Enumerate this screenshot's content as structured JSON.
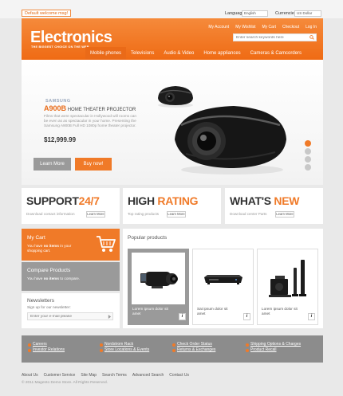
{
  "topbar": {
    "welcome": "Default welcome msg!",
    "language_label": "Language:",
    "language_value": "English",
    "currency_label": "Currencies:",
    "currency_value": "US Dollar"
  },
  "header": {
    "logo": "Electronics",
    "tagline": "THE BIGGEST CHOICE ON THE WEB",
    "links": [
      "My Account",
      "My Wishlist",
      "My Cart",
      "Checkout",
      "Log In"
    ],
    "search_placeholder": "Enter search keywords here"
  },
  "nav": {
    "items": [
      "Mobile phones",
      "Televisions",
      "Audio & Video",
      "Home appliances",
      "Cameras & Camcorders"
    ],
    "active_index": 0
  },
  "hero": {
    "brand": "SAMSUNG",
    "model": "A900B",
    "model_desc": "HOME THEATER PROJECTOR",
    "description": "Films that were spectacular in Hollywood will rooms can be even as as spectacular in your home. Presenting the Samsung A900B Full HD 1080p home theater projector.",
    "price": "$12,999.99",
    "learn_more": "Learn More",
    "buy_now": "Buy now!",
    "slides": 4,
    "active_slide": 0
  },
  "promos": [
    {
      "title_main": "SUPPORT",
      "title_accent": "24/7",
      "subtitle": "Download contact information",
      "button": "Learn More"
    },
    {
      "title_main": "HIGH",
      "title_accent": "RATING",
      "subtitle": "Top rating products",
      "button": "Learn More"
    },
    {
      "title_main": "WHAT'S",
      "title_accent": "NEW",
      "subtitle": "Download center Parts",
      "button": "Learn More"
    }
  ],
  "sidebar": {
    "cart_title": "My Cart",
    "cart_text_pre": "You have ",
    "cart_text_bold": "no items",
    "cart_text_post": " in your shopping cart.",
    "compare_title": "Compare  Products",
    "compare_text_pre": "You have ",
    "compare_text_bold": "no items",
    "compare_text_post": " to compare.",
    "newsletter_title": "Newsletters",
    "newsletter_text": "Sign up for our newsletter:",
    "newsletter_placeholder": "Enter your e-mail please"
  },
  "popular": {
    "title": "Popular products",
    "products": [
      {
        "name": "Lorem ipsum dolor sit amet",
        "icon": "camcorder-icon"
      },
      {
        "name": "Sat ipsum dolor sit amet",
        "icon": "dvd-player-icon"
      },
      {
        "name": "Lorem ipsum dolor sit amet",
        "icon": "home-theater-icon"
      }
    ],
    "info_label": "i"
  },
  "footer": {
    "columns": [
      [
        "Careers",
        "Investor Relations"
      ],
      [
        "Nordstrom Rack",
        "Store Locations & Events"
      ],
      [
        "Check Order Status",
        "Returns & Exchanges"
      ],
      [
        "Shipping Options & Charges",
        "Product Recall"
      ]
    ],
    "bottom_links": [
      "About Us",
      "Customer Service",
      "Site Map",
      "Search Terms",
      "Advanced Search",
      "Contact Us"
    ],
    "copyright": "© 2011 Magento Demo Store. All Rights Reserved."
  },
  "colors": {
    "accent": "#f07a28",
    "grey_box": "#9a9a9a",
    "footer_bar": "#8c8c8c"
  }
}
